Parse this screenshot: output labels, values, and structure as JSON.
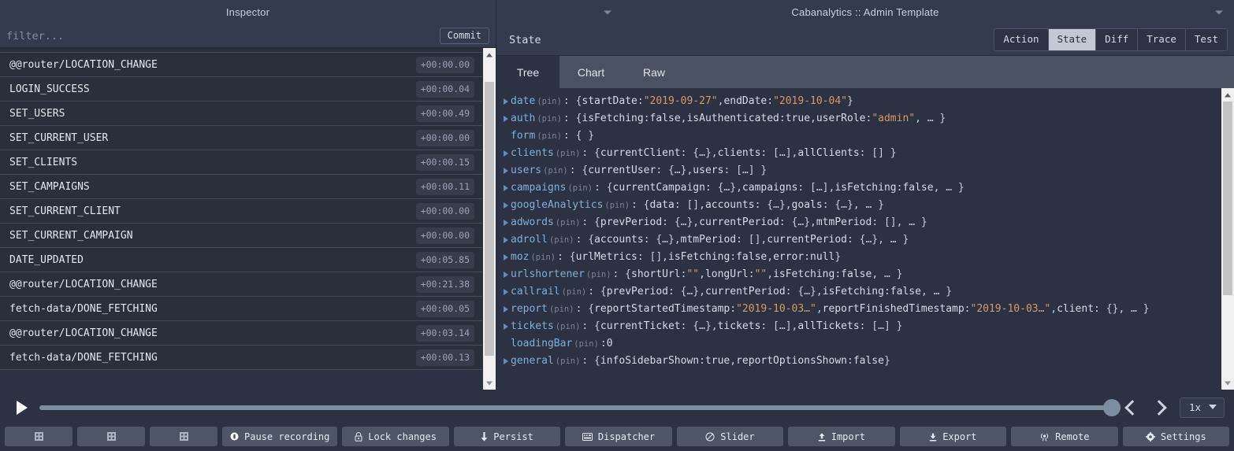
{
  "titlebar": {
    "left_title": "Inspector",
    "right_title": "Cabanalytics :: Admin Template",
    "caret_icon": "chevron-down-icon"
  },
  "filter": {
    "placeholder": "filter...",
    "value": "",
    "commit_label": "Commit"
  },
  "actions": {
    "rows": [
      {
        "name": "@@router/LOCATION_CHANGE",
        "time": "+00:00.00"
      },
      {
        "name": "LOGIN_SUCCESS",
        "time": "+00:00.04"
      },
      {
        "name": "SET_USERS",
        "time": "+00:00.49"
      },
      {
        "name": "SET_CURRENT_USER",
        "time": "+00:00.00"
      },
      {
        "name": "SET_CLIENTS",
        "time": "+00:00.15"
      },
      {
        "name": "SET_CAMPAIGNS",
        "time": "+00:00.11"
      },
      {
        "name": "SET_CURRENT_CLIENT",
        "time": "+00:00.00"
      },
      {
        "name": "SET_CURRENT_CAMPAIGN",
        "time": "+00:00.00"
      },
      {
        "name": "DATE_UPDATED",
        "time": "+00:05.85"
      },
      {
        "name": "@@router/LOCATION_CHANGE",
        "time": "+00:21.38"
      },
      {
        "name": "fetch-data/DONE_FETCHING",
        "time": "+00:00.05"
      },
      {
        "name": "@@router/LOCATION_CHANGE",
        "time": "+00:03.14"
      },
      {
        "name": "fetch-data/DONE_FETCHING",
        "time": "+00:00.13"
      }
    ]
  },
  "monitor": {
    "title": "State",
    "segments": [
      {
        "label": "Action",
        "active": false
      },
      {
        "label": "State",
        "active": true
      },
      {
        "label": "Diff",
        "active": false
      },
      {
        "label": "Trace",
        "active": false
      },
      {
        "label": "Test",
        "active": false
      }
    ],
    "tabs": [
      {
        "label": "Tree",
        "active": true
      },
      {
        "label": "Chart",
        "active": false
      },
      {
        "label": "Raw",
        "active": false
      }
    ]
  },
  "tree": {
    "pin_label": "(pin)",
    "nodes": [
      {
        "expandable": true,
        "key": "date",
        "parts": [
          {
            "t": "punc",
            "v": ": { "
          },
          {
            "t": "lit",
            "v": "startDate"
          },
          {
            "t": "punc",
            "v": ": "
          },
          {
            "t": "str",
            "v": "\"2019-09-27\""
          },
          {
            "t": "punc",
            "v": ", "
          },
          {
            "t": "lit",
            "v": "endDate"
          },
          {
            "t": "punc",
            "v": ": "
          },
          {
            "t": "str",
            "v": "\"2019-10-04\""
          },
          {
            "t": "punc",
            "v": " }"
          }
        ]
      },
      {
        "expandable": true,
        "key": "auth",
        "parts": [
          {
            "t": "punc",
            "v": ": { "
          },
          {
            "t": "lit",
            "v": "isFetching"
          },
          {
            "t": "punc",
            "v": ": "
          },
          {
            "t": "lit",
            "v": "false"
          },
          {
            "t": "punc",
            "v": ", "
          },
          {
            "t": "lit",
            "v": "isAuthenticated"
          },
          {
            "t": "punc",
            "v": ": "
          },
          {
            "t": "lit",
            "v": "true"
          },
          {
            "t": "punc",
            "v": ", "
          },
          {
            "t": "lit",
            "v": "userRole"
          },
          {
            "t": "punc",
            "v": ": "
          },
          {
            "t": "str",
            "v": "\"admin\""
          },
          {
            "t": "punc",
            "v": ", … }"
          }
        ]
      },
      {
        "expandable": false,
        "key": "form",
        "parts": [
          {
            "t": "punc",
            "v": ": { }"
          }
        ]
      },
      {
        "expandable": true,
        "key": "clients",
        "parts": [
          {
            "t": "punc",
            "v": ": { "
          },
          {
            "t": "lit",
            "v": "currentClient"
          },
          {
            "t": "punc",
            "v": ": {…}, "
          },
          {
            "t": "lit",
            "v": "clients"
          },
          {
            "t": "punc",
            "v": ": […], "
          },
          {
            "t": "lit",
            "v": "allClients"
          },
          {
            "t": "punc",
            "v": ": [] }"
          }
        ]
      },
      {
        "expandable": true,
        "key": "users",
        "parts": [
          {
            "t": "punc",
            "v": ": { "
          },
          {
            "t": "lit",
            "v": "currentUser"
          },
          {
            "t": "punc",
            "v": ": {…}, "
          },
          {
            "t": "lit",
            "v": "users"
          },
          {
            "t": "punc",
            "v": ": […] }"
          }
        ]
      },
      {
        "expandable": true,
        "key": "campaigns",
        "parts": [
          {
            "t": "punc",
            "v": ": { "
          },
          {
            "t": "lit",
            "v": "currentCampaign"
          },
          {
            "t": "punc",
            "v": ": {…}, "
          },
          {
            "t": "lit",
            "v": "campaigns"
          },
          {
            "t": "punc",
            "v": ": […], "
          },
          {
            "t": "lit",
            "v": "isFetching"
          },
          {
            "t": "punc",
            "v": ": "
          },
          {
            "t": "lit",
            "v": "false"
          },
          {
            "t": "punc",
            "v": ", … }"
          }
        ]
      },
      {
        "expandable": true,
        "key": "googleAnalytics",
        "parts": [
          {
            "t": "punc",
            "v": ": { "
          },
          {
            "t": "lit",
            "v": "data"
          },
          {
            "t": "punc",
            "v": ": [], "
          },
          {
            "t": "lit",
            "v": "accounts"
          },
          {
            "t": "punc",
            "v": ": {…}, "
          },
          {
            "t": "lit",
            "v": "goals"
          },
          {
            "t": "punc",
            "v": ": {…}, … }"
          }
        ]
      },
      {
        "expandable": true,
        "key": "adwords",
        "parts": [
          {
            "t": "punc",
            "v": ": { "
          },
          {
            "t": "lit",
            "v": "prevPeriod"
          },
          {
            "t": "punc",
            "v": ": {…}, "
          },
          {
            "t": "lit",
            "v": "currentPeriod"
          },
          {
            "t": "punc",
            "v": ": {…}, "
          },
          {
            "t": "lit",
            "v": "mtmPeriod"
          },
          {
            "t": "punc",
            "v": ": [], … }"
          }
        ]
      },
      {
        "expandable": true,
        "key": "adroll",
        "parts": [
          {
            "t": "punc",
            "v": ": { "
          },
          {
            "t": "lit",
            "v": "accounts"
          },
          {
            "t": "punc",
            "v": ": {…}, "
          },
          {
            "t": "lit",
            "v": "mtmPeriod"
          },
          {
            "t": "punc",
            "v": ": [], "
          },
          {
            "t": "lit",
            "v": "currentPeriod"
          },
          {
            "t": "punc",
            "v": ": {…}, … }"
          }
        ]
      },
      {
        "expandable": true,
        "key": "moz",
        "parts": [
          {
            "t": "punc",
            "v": ": { "
          },
          {
            "t": "lit",
            "v": "urlMetrics"
          },
          {
            "t": "punc",
            "v": ": [], "
          },
          {
            "t": "lit",
            "v": "isFetching"
          },
          {
            "t": "punc",
            "v": ": "
          },
          {
            "t": "lit",
            "v": "false"
          },
          {
            "t": "punc",
            "v": ", "
          },
          {
            "t": "lit",
            "v": "error"
          },
          {
            "t": "punc",
            "v": ": "
          },
          {
            "t": "lit",
            "v": "null"
          },
          {
            "t": "punc",
            "v": " }"
          }
        ]
      },
      {
        "expandable": true,
        "key": "urlshortener",
        "parts": [
          {
            "t": "punc",
            "v": ": { "
          },
          {
            "t": "lit",
            "v": "shortUrl"
          },
          {
            "t": "punc",
            "v": ": "
          },
          {
            "t": "str",
            "v": "\"\""
          },
          {
            "t": "punc",
            "v": ", "
          },
          {
            "t": "lit",
            "v": "longUrl"
          },
          {
            "t": "punc",
            "v": ": "
          },
          {
            "t": "str",
            "v": "\"\""
          },
          {
            "t": "punc",
            "v": ", "
          },
          {
            "t": "lit",
            "v": "isFetching"
          },
          {
            "t": "punc",
            "v": ": "
          },
          {
            "t": "lit",
            "v": "false"
          },
          {
            "t": "punc",
            "v": ", … }"
          }
        ]
      },
      {
        "expandable": true,
        "key": "callrail",
        "parts": [
          {
            "t": "punc",
            "v": ": { "
          },
          {
            "t": "lit",
            "v": "prevPeriod"
          },
          {
            "t": "punc",
            "v": ": {…}, "
          },
          {
            "t": "lit",
            "v": "currentPeriod"
          },
          {
            "t": "punc",
            "v": ": {…}, "
          },
          {
            "t": "lit",
            "v": "isFetching"
          },
          {
            "t": "punc",
            "v": ": "
          },
          {
            "t": "lit",
            "v": "false"
          },
          {
            "t": "punc",
            "v": ", … }"
          }
        ]
      },
      {
        "expandable": true,
        "key": "report",
        "parts": [
          {
            "t": "punc",
            "v": ": { "
          },
          {
            "t": "lit",
            "v": "reportStartedTimestamp"
          },
          {
            "t": "punc",
            "v": ": "
          },
          {
            "t": "str",
            "v": "\"2019-10-03…\""
          },
          {
            "t": "punc",
            "v": ", "
          },
          {
            "t": "lit",
            "v": "reportFinishedTimestamp"
          },
          {
            "t": "punc",
            "v": ": "
          },
          {
            "t": "str",
            "v": "\"2019-10-03…\""
          },
          {
            "t": "punc",
            "v": ", "
          },
          {
            "t": "lit",
            "v": "client"
          },
          {
            "t": "punc",
            "v": ": {}, … }"
          }
        ]
      },
      {
        "expandable": true,
        "key": "tickets",
        "parts": [
          {
            "t": "punc",
            "v": ": { "
          },
          {
            "t": "lit",
            "v": "currentTicket"
          },
          {
            "t": "punc",
            "v": ": {…}, "
          },
          {
            "t": "lit",
            "v": "tickets"
          },
          {
            "t": "punc",
            "v": ": […], "
          },
          {
            "t": "lit",
            "v": "allTickets"
          },
          {
            "t": "punc",
            "v": ": […] }"
          }
        ]
      },
      {
        "expandable": false,
        "key": "loadingBar",
        "parts": [
          {
            "t": "punc",
            "v": ": "
          },
          {
            "t": "num",
            "v": "0"
          }
        ]
      },
      {
        "expandable": true,
        "key": "general",
        "parts": [
          {
            "t": "punc",
            "v": ": { "
          },
          {
            "t": "lit",
            "v": "infoSidebarShown"
          },
          {
            "t": "punc",
            "v": ": "
          },
          {
            "t": "lit",
            "v": "true"
          },
          {
            "t": "punc",
            "v": ", "
          },
          {
            "t": "lit",
            "v": "reportOptionsShown"
          },
          {
            "t": "punc",
            "v": ": "
          },
          {
            "t": "lit",
            "v": "false"
          },
          {
            "t": "punc",
            "v": " }"
          }
        ]
      }
    ]
  },
  "player": {
    "play_icon": "play-icon",
    "prev_icon": "chevron-left-icon",
    "next_icon": "chevron-right-icon",
    "speed_value": "1x",
    "speed_caret_icon": "chevron-down-icon",
    "slider_position_percent": 100
  },
  "toolbar": {
    "buttons": [
      {
        "label": "",
        "icon": "grid-icon",
        "icon_only": true
      },
      {
        "label": "",
        "icon": "grid-icon",
        "icon_only": true
      },
      {
        "label": "",
        "icon": "grid-icon",
        "icon_only": true
      },
      {
        "label": "Pause recording",
        "icon": "record-icon",
        "icon_only": false
      },
      {
        "label": "Lock changes",
        "icon": "lock-icon",
        "icon_only": false
      },
      {
        "label": "Persist",
        "icon": "pin-icon",
        "icon_only": false
      },
      {
        "label": "Dispatcher",
        "icon": "keyboard-icon",
        "icon_only": false
      },
      {
        "label": "Slider",
        "icon": "slider-icon",
        "icon_only": false
      },
      {
        "label": "Import",
        "icon": "upload-icon",
        "icon_only": false
      },
      {
        "label": "Export",
        "icon": "download-icon",
        "icon_only": false
      },
      {
        "label": "Remote",
        "icon": "broadcast-icon",
        "icon_only": false
      },
      {
        "label": "Settings",
        "icon": "gear-icon",
        "icon_only": false
      }
    ]
  },
  "colors": {
    "background": "#2c3242",
    "panel": "#343b4d",
    "row": "#2a2f3c",
    "accent_key": "#7fb0d8",
    "accent_string": "#d49a6a",
    "button": "#4e5665"
  }
}
